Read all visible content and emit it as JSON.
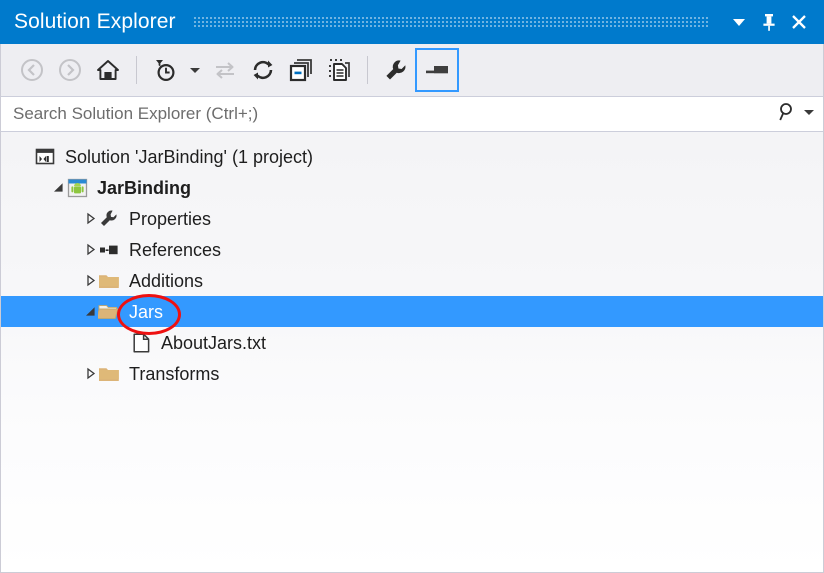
{
  "window": {
    "title": "Solution Explorer",
    "accent_color": "#007acc",
    "selection_color": "#3399ff",
    "annotation_color": "#ee1111",
    "controls": [
      {
        "name": "chevron-down-icon",
        "label": "Window position dropdown"
      },
      {
        "name": "pin-icon",
        "label": "Auto Hide"
      },
      {
        "name": "close-icon",
        "label": "Close"
      }
    ]
  },
  "toolbar": {
    "items": [
      {
        "name": "back-button",
        "label": "Navigate Backward",
        "enabled": false
      },
      {
        "name": "forward-button",
        "label": "Navigate Forward",
        "enabled": false
      },
      {
        "name": "home-button",
        "label": "Home",
        "enabled": true
      },
      {
        "name": "pending-changes-filter-button",
        "label": "Pending Changes Filter",
        "enabled": true
      },
      {
        "name": "pending-changes-dropdown",
        "label": "Filter options",
        "enabled": true
      },
      {
        "name": "sync-with-active-document-button",
        "label": "Sync with Active Document",
        "enabled": false
      },
      {
        "name": "refresh-button",
        "label": "Refresh",
        "enabled": true
      },
      {
        "name": "collapse-all-button",
        "label": "Collapse All",
        "enabled": true
      },
      {
        "name": "show-all-files-button",
        "label": "Show All Files",
        "enabled": true
      },
      {
        "name": "properties-button",
        "label": "Properties",
        "enabled": true
      },
      {
        "name": "preview-selected-items-button",
        "label": "Preview Selected Items",
        "enabled": true,
        "active": true
      }
    ]
  },
  "search": {
    "placeholder": "Search Solution Explorer (Ctrl+;)",
    "value": "",
    "icon": "search-icon",
    "dropdown_icon": "chevron-down-icon"
  },
  "tree": {
    "nodes": [
      {
        "label": "Solution 'JarBinding' (1 project)",
        "icon": "solution-icon",
        "indent": 0,
        "twisty": "none",
        "bold": false,
        "selected": false
      },
      {
        "label": "JarBinding",
        "icon": "android-project-icon",
        "indent": 1,
        "twisty": "expanded",
        "bold": true,
        "selected": false
      },
      {
        "label": "Properties",
        "icon": "wrench-icon",
        "indent": 2,
        "twisty": "collapsed",
        "bold": false,
        "selected": false
      },
      {
        "label": "References",
        "icon": "references-icon",
        "indent": 2,
        "twisty": "collapsed",
        "bold": false,
        "selected": false
      },
      {
        "label": "Additions",
        "icon": "folder-icon",
        "indent": 2,
        "twisty": "collapsed",
        "bold": false,
        "selected": false
      },
      {
        "label": "Jars",
        "icon": "folder-open-icon",
        "indent": 2,
        "twisty": "expanded",
        "bold": false,
        "selected": true,
        "annotated": true
      },
      {
        "label": "AboutJars.txt",
        "icon": "text-file-icon",
        "indent": 3,
        "twisty": "none",
        "bold": false,
        "selected": false
      },
      {
        "label": "Transforms",
        "icon": "folder-icon",
        "indent": 2,
        "twisty": "collapsed",
        "bold": false,
        "selected": false
      }
    ]
  }
}
